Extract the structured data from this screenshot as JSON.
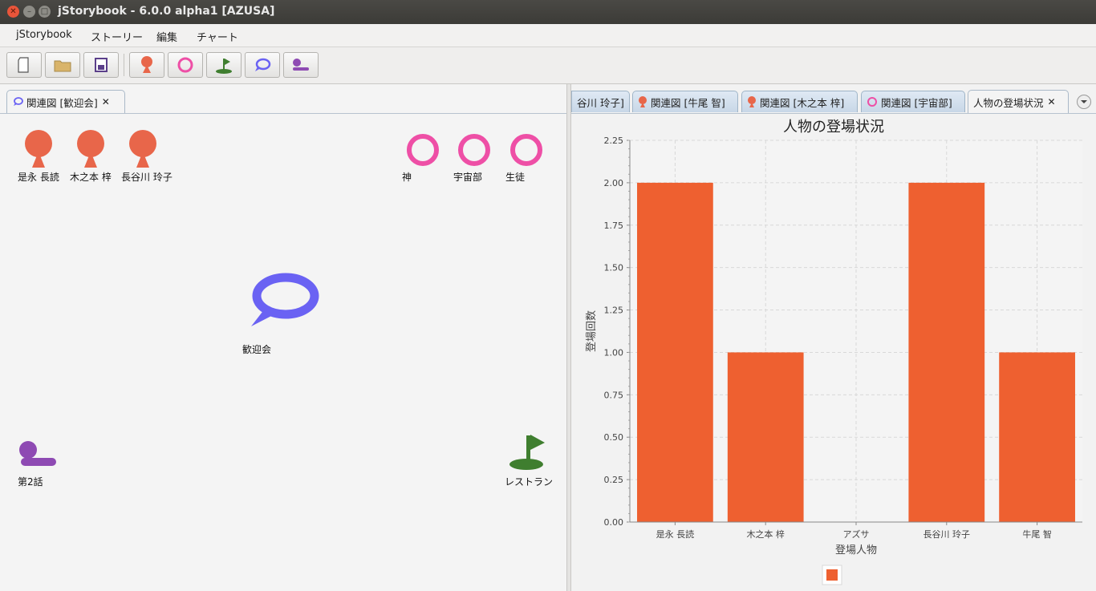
{
  "window": {
    "title": "jStorybook - 6.0.0 alpha1 [AZUSA]"
  },
  "menu": {
    "items": [
      "jStorybook",
      "ストーリー",
      "編集",
      "チャート"
    ]
  },
  "toolbar": {
    "buttons": [
      "new-file-icon",
      "open-folder-icon",
      "save-icon",
      "person-icon",
      "group-icon",
      "place-icon",
      "scene-icon",
      "chapter-icon"
    ]
  },
  "left": {
    "tab_label": "関連図 [歓迎会]",
    "tab_close": "✕",
    "persons": [
      "是永 長読",
      "木之本 梓",
      "長谷川 玲子"
    ],
    "groups": [
      "神",
      "宇宙部",
      "生徒"
    ],
    "scene": "歓迎会",
    "chapter": "第2話",
    "place": "レストラン"
  },
  "right": {
    "tabs": [
      "谷川 玲子]",
      "関連図 [牛尾 智]",
      "関連図 [木之本 梓]",
      "関連図 [宇宙部]",
      "人物の登場状況"
    ],
    "tab_close": "✕"
  },
  "colors": {
    "bar": "#ee6030",
    "person": "#e8664a",
    "group": "#ee4fa6",
    "scene": "#6a62f3",
    "chapter": "#8e4ab3",
    "place": "#3f7e2f"
  },
  "chart_data": {
    "type": "bar",
    "title": "人物の登場状況",
    "xlabel": "登場人物",
    "ylabel": "登場回数",
    "categories": [
      "是永 長読",
      "木之本 梓",
      "アズサ",
      "長谷川 玲子",
      "牛尾 智"
    ],
    "values": [
      2,
      1,
      0,
      2,
      1
    ],
    "ylim": [
      0,
      2.25
    ],
    "yticks": [
      "0.00",
      "0.25",
      "0.50",
      "0.75",
      "1.00",
      "1.25",
      "1.50",
      "1.75",
      "2.00",
      "2.25"
    ],
    "grid": true,
    "legend": "bottom"
  }
}
